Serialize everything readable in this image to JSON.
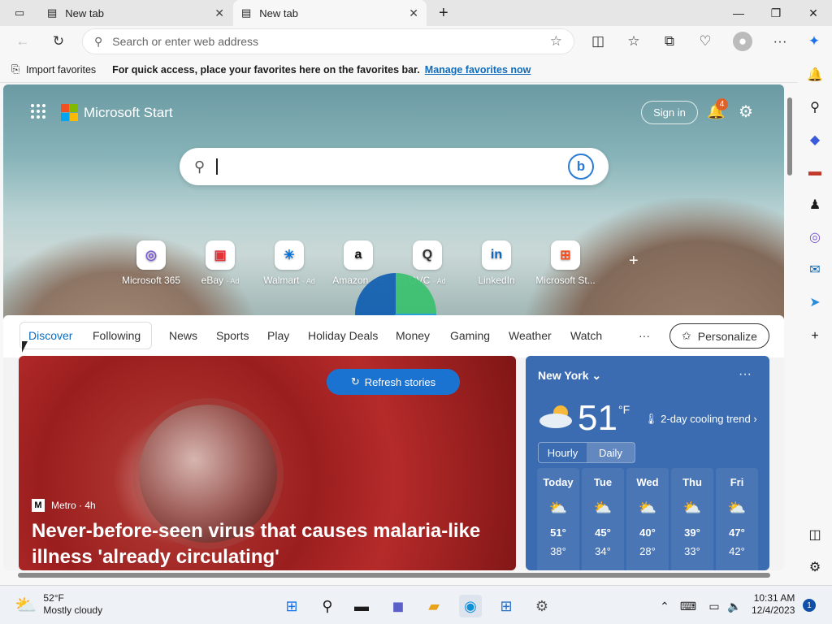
{
  "tabs": [
    {
      "title": "New tab"
    },
    {
      "title": "New tab"
    }
  ],
  "address": {
    "placeholder": "Search or enter web address"
  },
  "favorites_bar": {
    "import_label": "Import favorites",
    "hint": "For quick access, place your favorites here on the favorites bar.",
    "manage_link": "Manage favorites now"
  },
  "header": {
    "brand": "Microsoft Start",
    "sign_in": "Sign in",
    "notification_count": "4"
  },
  "quick_links": [
    {
      "name": "Microsoft 365",
      "ad": "",
      "icon": "ms365-icon",
      "glyph": "◎",
      "color": "#7b5ad6"
    },
    {
      "name": "eBay",
      "ad": "· Ad",
      "icon": "ebay-icon",
      "glyph": "▣",
      "color": "#e53238"
    },
    {
      "name": "Walmart",
      "ad": "· Ad",
      "icon": "walmart-icon",
      "glyph": "✳",
      "color": "#0071dc"
    },
    {
      "name": "Amazon",
      "ad": "· Ad",
      "icon": "amazon-icon",
      "glyph": "a",
      "color": "#111111"
    },
    {
      "name": "QVC",
      "ad": "· Ad",
      "icon": "qvc-icon",
      "glyph": "Q",
      "color": "#333333"
    },
    {
      "name": "LinkedIn",
      "ad": "",
      "icon": "linkedin-icon",
      "glyph": "in",
      "color": "#0a66c2"
    },
    {
      "name": "Microsoft St...",
      "ad": "",
      "icon": "microsoft-store-icon",
      "glyph": "⊞",
      "color": "#f25022"
    }
  ],
  "feed_nav": {
    "items": [
      "Discover",
      "Following",
      "News",
      "Sports",
      "Play",
      "Holiday Deals",
      "Money",
      "Gaming",
      "Weather",
      "Watch"
    ],
    "more": "···",
    "personalize": "Personalize"
  },
  "news": {
    "refresh": "Refresh stories",
    "source": "Metro · 4h",
    "headline": "Never-before-seen virus that causes malaria-like illness 'already circulating'"
  },
  "weather": {
    "city": "New York",
    "temp": "51",
    "unit": "°F",
    "trend": "2-day cooling trend",
    "tabs": [
      "Hourly",
      "Daily"
    ],
    "days": [
      {
        "name": "Today",
        "hi": "51°",
        "lo": "38°"
      },
      {
        "name": "Tue",
        "hi": "45°",
        "lo": "34°"
      },
      {
        "name": "Wed",
        "hi": "40°",
        "lo": "28°"
      },
      {
        "name": "Thu",
        "hi": "39°",
        "lo": "33°"
      },
      {
        "name": "Fri",
        "hi": "47°",
        "lo": "42°"
      }
    ]
  },
  "taskbar": {
    "weather_temp": "52°F",
    "weather_desc": "Mostly cloudy",
    "time": "10:31 AM",
    "date": "12/4/2023",
    "notifications": "1"
  },
  "colors": {
    "accent": "#0f6cbd",
    "weather_bg": "#3b6bb0",
    "refresh": "#1b73d1",
    "badge": "#e0622b"
  }
}
